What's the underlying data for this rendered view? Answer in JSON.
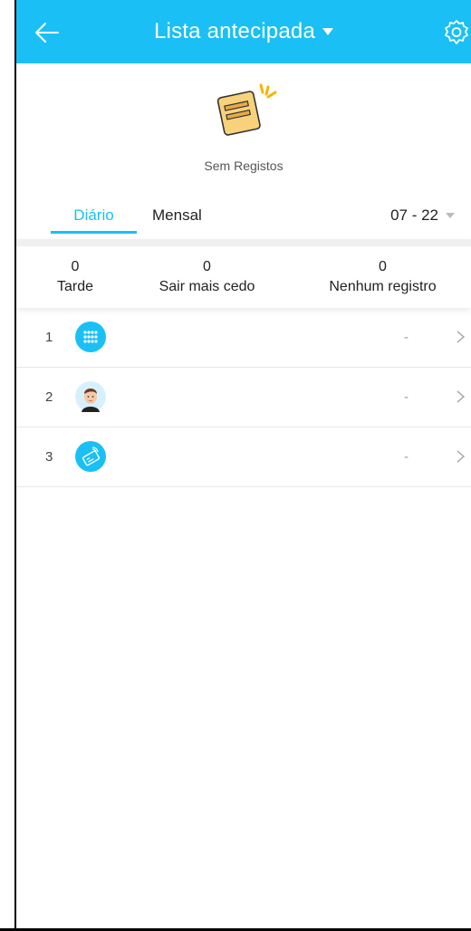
{
  "header": {
    "title": "Lista antecipada",
    "accent_color": "#1ac0f5"
  },
  "empty_state": {
    "icon": "empty-notes-icon",
    "text": "Sem Registos"
  },
  "tabs": {
    "daily": "Diário",
    "monthly": "Mensal",
    "active": "daily"
  },
  "date_selector": {
    "value": "07 - 22"
  },
  "stats": [
    {
      "value": "0",
      "label": "Tarde"
    },
    {
      "value": "0",
      "label": "Sair mais cedo"
    },
    {
      "value": "0",
      "label": "Nenhum registro"
    }
  ],
  "rows": [
    {
      "index": "1",
      "icon": "keypad-icon",
      "value": "-"
    },
    {
      "index": "2",
      "icon": "face-avatar-icon",
      "value": "-"
    },
    {
      "index": "3",
      "icon": "card-swipe-icon",
      "value": "-"
    }
  ]
}
